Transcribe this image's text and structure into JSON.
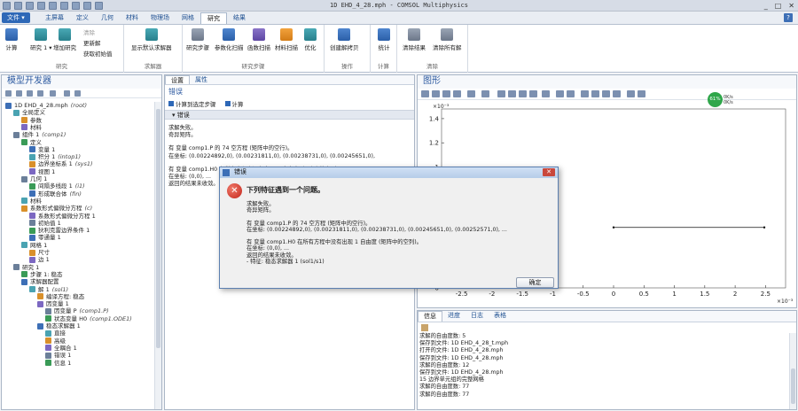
{
  "window": {
    "title": "1D EHD_4_28.mph - COMSOL Multiphysics",
    "controls": [
      "_",
      "□",
      "✕"
    ]
  },
  "menu": {
    "file": "文件 ▾",
    "tabs": [
      "主屏幕",
      "定义",
      "几何",
      "材料",
      "物理场",
      "网格",
      "研究",
      "结果"
    ],
    "active_tab": "研究",
    "help": "?"
  },
  "ribbon": {
    "study_group": {
      "label": "研究",
      "compute": "计算",
      "study": "研究 1 ▾",
      "add_study": "增加研究",
      "clear": "清除",
      "update": "更新解",
      "get_initial": "获取初始值"
    },
    "solver_group": {
      "label": "求解器",
      "show_default": "显示默认求解器"
    },
    "steps_group": {
      "label": "研究步骤",
      "study_steps": "研究步骤",
      "param_sweep": "参数化扫描",
      "func_sweep": "函数扫描",
      "material_sweep": "材料扫描",
      "optimize": "优化"
    },
    "ops_group": {
      "label": "操作",
      "create_copy": "创建解拷贝"
    },
    "stats_group": {
      "label": "计算",
      "stats": "统计"
    },
    "clear_group": {
      "label": "清除",
      "clear_results": "清除结果",
      "clear_all": "清除所有解"
    }
  },
  "model_builder": {
    "title": "模型开发器",
    "tree": [
      {
        "label": "1D EHD_4_28.mph",
        "tag": "(root)",
        "indent": 0,
        "icon": "root-icon"
      },
      {
        "label": "全局定义",
        "tag": "",
        "indent": 1,
        "icon": "globe-icon"
      },
      {
        "label": "参数",
        "tag": "",
        "indent": 2,
        "icon": "parameter-icon"
      },
      {
        "label": "材料",
        "tag": "",
        "indent": 2,
        "icon": "material-icon"
      },
      {
        "label": "组件 1",
        "tag": "(comp1)",
        "indent": 1,
        "icon": "component-icon"
      },
      {
        "label": "定义",
        "tag": "",
        "indent": 2,
        "icon": "definitions-icon"
      },
      {
        "label": "变量 1",
        "tag": "",
        "indent": 3,
        "icon": "variable-icon"
      },
      {
        "label": "积分 1",
        "tag": "(intop1)",
        "indent": 3,
        "icon": "integration-icon"
      },
      {
        "label": "边界坐标系 1",
        "tag": "(sys1)",
        "indent": 3,
        "icon": "coordinate-system-icon"
      },
      {
        "label": "视图 1",
        "tag": "",
        "indent": 3,
        "icon": "view-icon"
      },
      {
        "label": "几何 1",
        "tag": "",
        "indent": 2,
        "icon": "geometry-icon"
      },
      {
        "label": "间隔多线段 1",
        "tag": "(i1)",
        "indent": 3,
        "icon": "interval-icon"
      },
      {
        "label": "形成联合体",
        "tag": "(fin)",
        "indent": 3,
        "icon": "form-union-icon"
      },
      {
        "label": "材料",
        "tag": "",
        "indent": 2,
        "icon": "material-icon"
      },
      {
        "label": "系数形式偏微分方程",
        "tag": "(c)",
        "indent": 2,
        "icon": "pde-icon"
      },
      {
        "label": "系数形式偏微分方程 1",
        "tag": "",
        "indent": 3,
        "icon": "pde-node-icon"
      },
      {
        "label": "初始值 1",
        "tag": "",
        "indent": 3,
        "icon": "initial-values-icon"
      },
      {
        "label": "狄利克雷边界条件 1",
        "tag": "",
        "indent": 3,
        "icon": "boundary-icon"
      },
      {
        "label": "零通量 1",
        "tag": "",
        "indent": 3,
        "icon": "zero-flux-icon"
      },
      {
        "label": "网格 1",
        "tag": "",
        "indent": 2,
        "icon": "mesh-icon"
      },
      {
        "label": "尺寸",
        "tag": "",
        "indent": 3,
        "icon": "size-icon"
      },
      {
        "label": "边 1",
        "tag": "",
        "indent": 3,
        "icon": "edge-icon"
      },
      {
        "label": "研究 1",
        "tag": "",
        "indent": 1,
        "icon": "study-icon"
      },
      {
        "label": "步骤 1: 稳态",
        "tag": "",
        "indent": 2,
        "icon": "step-icon"
      },
      {
        "label": "求解器配置",
        "tag": "",
        "indent": 2,
        "icon": "solver-config-icon"
      },
      {
        "label": "解 1",
        "tag": "(sol1)",
        "indent": 3,
        "icon": "solution-icon"
      },
      {
        "label": "编译方程: 稳态",
        "tag": "",
        "indent": 4,
        "icon": "compile-icon"
      },
      {
        "label": "因变量 1",
        "tag": "",
        "indent": 4,
        "icon": "dependent-variables-icon"
      },
      {
        "label": "因变量 P",
        "tag": "(comp1.P)",
        "indent": 5,
        "icon": "field-icon"
      },
      {
        "label": "状态变量 H0",
        "tag": "(comp1.ODE1)",
        "indent": 5,
        "icon": "state-icon"
      },
      {
        "label": "稳态求解器 1",
        "tag": "",
        "indent": 4,
        "icon": "stationary-solver-icon"
      },
      {
        "label": "直接",
        "tag": "",
        "indent": 5,
        "icon": "direct-icon"
      },
      {
        "label": "高级",
        "tag": "",
        "indent": 5,
        "icon": "advanced-icon"
      },
      {
        "label": "全耦合 1",
        "tag": "",
        "indent": 5,
        "icon": "fully-coupled-icon"
      },
      {
        "label": "错误 1",
        "tag": "",
        "indent": 5,
        "icon": "error-node-icon"
      },
      {
        "label": "信息 1",
        "tag": "",
        "indent": 5,
        "icon": "info-icon"
      }
    ]
  },
  "settings": {
    "tabs": [
      "设置",
      "属性"
    ],
    "node_title": "错误",
    "toolbar": [
      "计算到选定步骤",
      "计算"
    ],
    "section": "错误",
    "lines": [
      "求解失败。",
      "奇异矩阵。",
      "",
      "有 变量 comp1.P 的 74 空方程 (矩阵中的空行)。",
      "在坐标: (0.00224892,0), (0.00231811,0), (0.00238731,0), (0.00245651,0),",
      "",
      "有 变量 comp1.H0 在所有方程中没有出现 1 自由度 (矩阵中的空列)。",
      "在坐标: (0,0), ...",
      "返回的结果未收敛。"
    ]
  },
  "graphics": {
    "title": "图形",
    "badge": "61%",
    "badge_extra": [
      "0K/s",
      "0K/s"
    ],
    "chart_data": {
      "type": "line",
      "x_multiplier": "×10⁻³",
      "y_multiplier": "×10⁻³",
      "xticks": [
        "-2.5",
        "-2",
        "-1.5",
        "-1",
        "-0.5",
        "0",
        "0.5",
        "1",
        "1.5",
        "2",
        "2.5"
      ],
      "yticks": [
        "1.4",
        "1.2",
        "1",
        "0.8",
        "0.6",
        "0.4",
        "0.2",
        "0"
      ],
      "series": [
        {
          "x": [
            0,
            0.00248
          ],
          "y": [
            0.0005,
            0.0005
          ]
        }
      ],
      "xlim": [
        -0.00283,
        0.00283
      ],
      "ylim": [
        0,
        0.00148
      ],
      "grid": false
    }
  },
  "messages": {
    "tabs": [
      "信息",
      "进度",
      "日志",
      "表格"
    ],
    "active_tab": "信息",
    "lines": [
      "求解的自由度数: 5",
      "保存到文件: 1D EHD_4_28_t.mph",
      "打开的文件: 1D EHD_4_28.mph",
      "保存到文件: 1D EHD_4_28.mph",
      "求解的自由度数: 12",
      "保存到文件: 1D EHD_4_28.mph",
      "15 边界单元组的完整网格",
      "求解的自由度数: 77",
      "求解的自由度数: 77"
    ]
  },
  "dialog": {
    "title": "错误",
    "heading": "下列特征遇到一个问题。",
    "lines": [
      "求解失败。",
      "奇异矩阵。",
      "",
      "有 变量 comp1.P 的 74 空方程 (矩阵中的空行)。",
      "在坐标: (0.00224892,0), (0.00231811,0), (0.00238731,0), (0.00245651,0), (0.00252571,0), ...",
      "",
      "有 变量 comp1.H0 在所有方程中没有出现 1 自由度 (矩阵中的空列)。",
      "在坐标: (0,0), ...",
      "返回的结果未收敛。",
      "  - 特征: 稳态求解器 1 (sol1/s1)"
    ],
    "ok": "确定"
  },
  "colors": {
    "accent": "#2e68b7",
    "error": "#c3241a",
    "badge": "#2fa64a"
  }
}
